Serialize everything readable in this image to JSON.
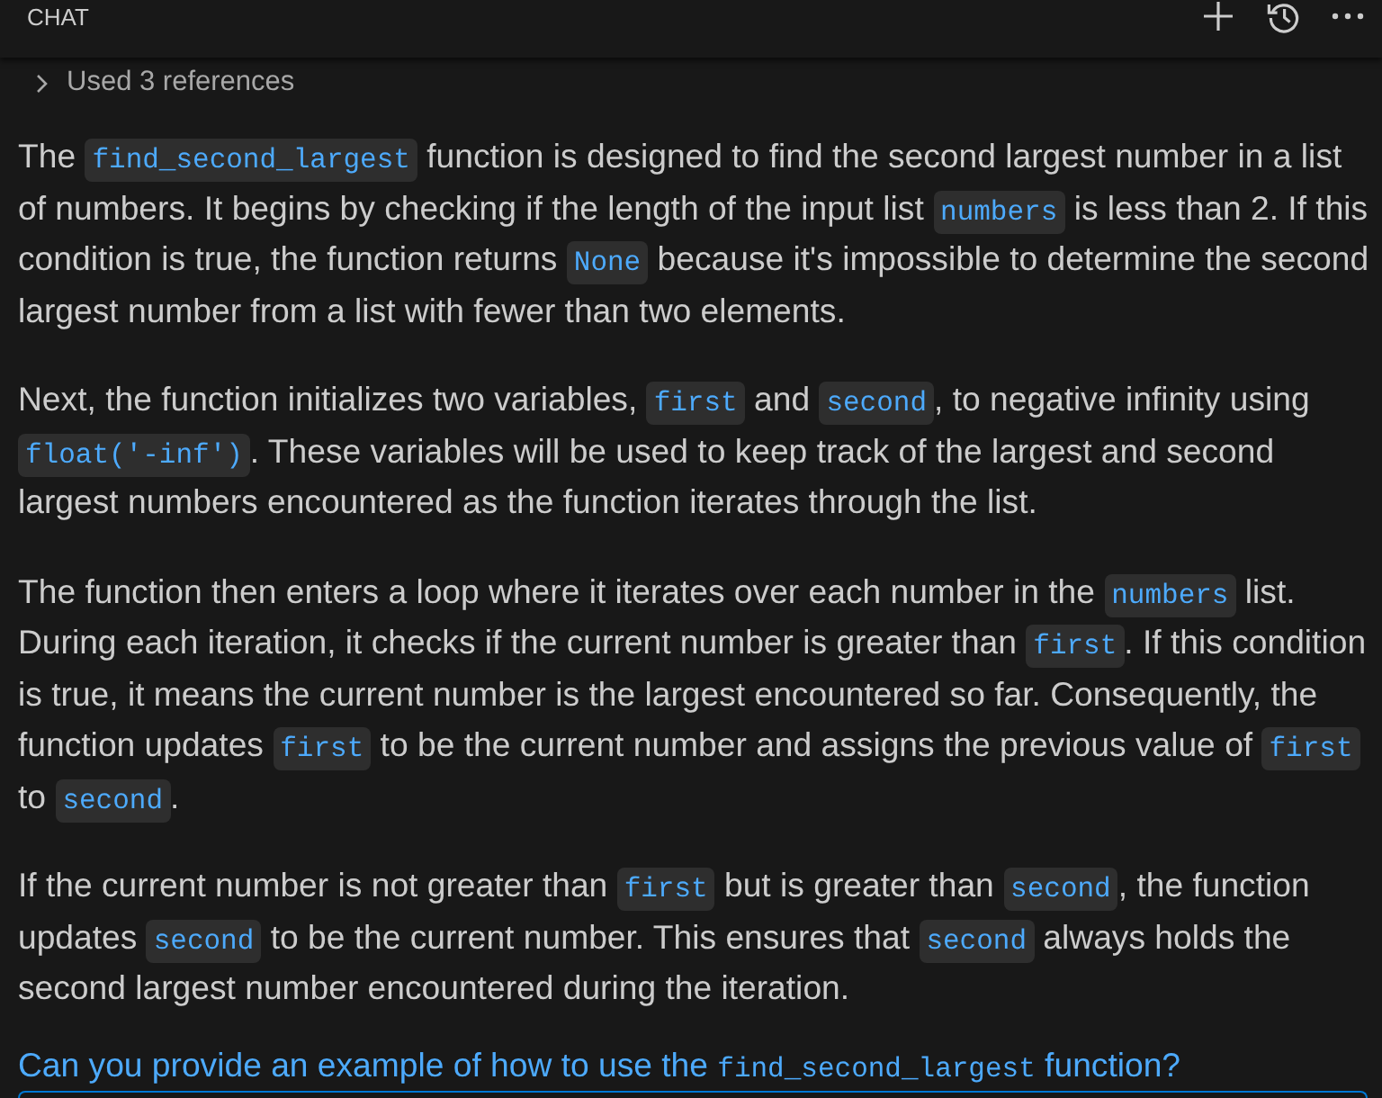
{
  "panel": {
    "title": "CHAT"
  },
  "references": {
    "label": "Used 3 references",
    "expanded": false
  },
  "response": {
    "paragraphs": [
      [
        {
          "kind": "text",
          "text": "The "
        },
        {
          "kind": "code",
          "text": "find_second_largest"
        },
        {
          "kind": "text",
          "text": " function is designed to find the second largest number in a list of numbers. It begins by checking if the length of the input list "
        },
        {
          "kind": "code",
          "text": "numbers"
        },
        {
          "kind": "text",
          "text": " is less than 2. If this condition is true, the function returns "
        },
        {
          "kind": "code",
          "text": "None"
        },
        {
          "kind": "text",
          "text": " because it's impossible to determine the second largest number from a list with fewer than two elements."
        }
      ],
      [
        {
          "kind": "text",
          "text": "Next, the function initializes two variables, "
        },
        {
          "kind": "code",
          "text": "first"
        },
        {
          "kind": "text",
          "text": " and "
        },
        {
          "kind": "code",
          "text": "second"
        },
        {
          "kind": "text",
          "text": ", to negative infinity using "
        },
        {
          "kind": "code",
          "text": "float('-inf')"
        },
        {
          "kind": "text",
          "text": ". These variables will be used to keep track of the largest and second largest numbers encountered as the function iterates through the list."
        }
      ],
      [
        {
          "kind": "text",
          "text": "The function then enters a loop where it iterates over each number in the "
        },
        {
          "kind": "code",
          "text": "numbers"
        },
        {
          "kind": "text",
          "text": " list. During each iteration, it checks if the current number is greater than "
        },
        {
          "kind": "code",
          "text": "first"
        },
        {
          "kind": "text",
          "text": ". If this condition is true, it means the current number is the largest encountered so far. Consequently, the function updates "
        },
        {
          "kind": "code",
          "text": "first"
        },
        {
          "kind": "text",
          "text": " to be the current number and assigns the previous value of "
        },
        {
          "kind": "code",
          "text": "first"
        },
        {
          "kind": "text",
          "text": " to "
        },
        {
          "kind": "code",
          "text": "second"
        },
        {
          "kind": "text",
          "text": "."
        }
      ],
      [
        {
          "kind": "text",
          "text": "If the current number is not greater than "
        },
        {
          "kind": "code",
          "text": "first"
        },
        {
          "kind": "text",
          "text": " but is greater than "
        },
        {
          "kind": "code",
          "text": "second"
        },
        {
          "kind": "text",
          "text": ", the function updates "
        },
        {
          "kind": "code",
          "text": "second"
        },
        {
          "kind": "text",
          "text": " to be the current number. This ensures that "
        },
        {
          "kind": "code",
          "text": "second"
        },
        {
          "kind": "text",
          "text": " always holds the second largest number encountered during the iteration."
        }
      ]
    ]
  },
  "followup": {
    "segments": [
      {
        "kind": "text",
        "text": "Can you provide an example of how to use the "
      },
      {
        "kind": "code",
        "text": "find_second_largest"
      },
      {
        "kind": "text",
        "text": " function?"
      }
    ]
  }
}
